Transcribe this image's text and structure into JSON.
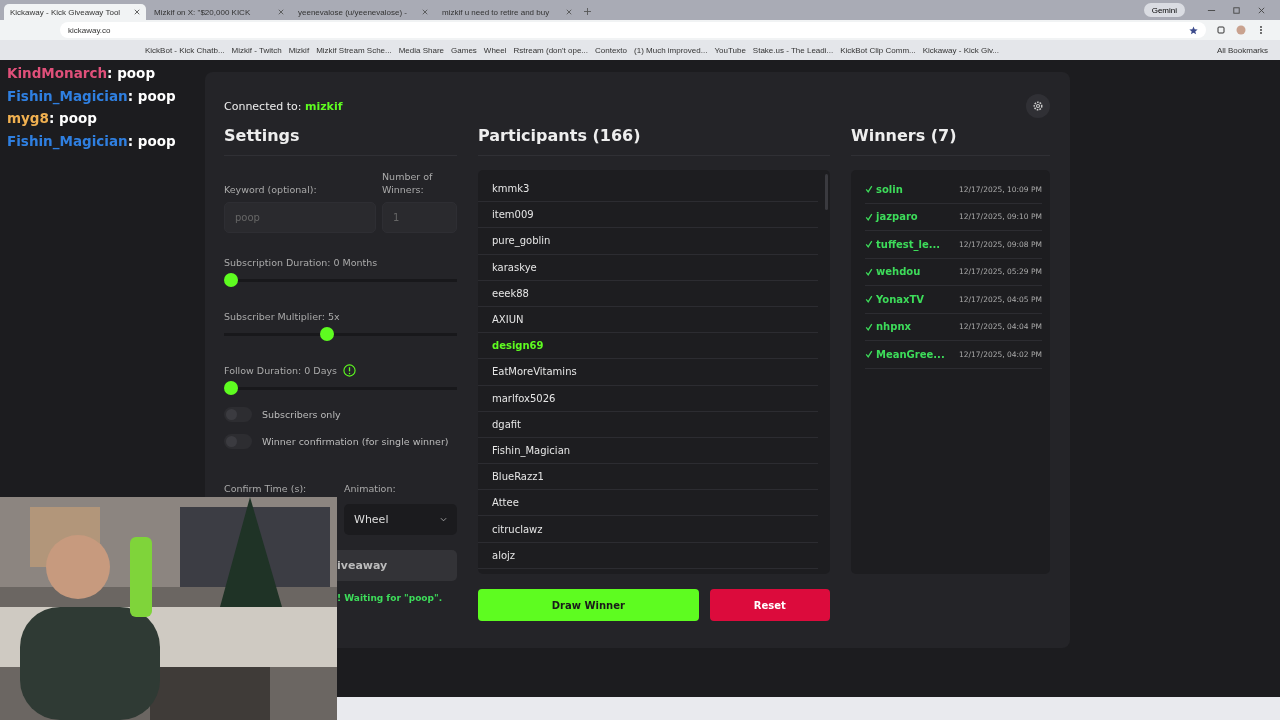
{
  "browser": {
    "tabs": [
      {
        "title": "Kickaway - Kick Giveaway Tool",
        "selected": true
      },
      {
        "title": "Mizkif on X: \"$20,000 KICK",
        "selected": false
      },
      {
        "title": "yeenevalose (u/yeenevalose) -",
        "selected": false
      },
      {
        "title": "mizkif u need to retire and buy",
        "selected": false
      }
    ],
    "gemini_label": "Gemini",
    "address": "kickaway.co",
    "bookmarks": [
      "KickBot - Kick Chatb...",
      "Mizkif - Twitch",
      "Mizkif",
      "Mizkif Stream Sche...",
      "Media Share",
      "Games",
      "Wheel",
      "Rstream (don't ope...",
      "Contexto",
      "(1) Much improved...",
      "YouTube",
      "Stake.us - The Leadi...",
      "KickBot Clip Comm...",
      "Kickaway - Kick Giv..."
    ],
    "all_bookmarks": "All Bookmarks"
  },
  "chat": [
    {
      "user": "KindMonarch",
      "text": ": poop",
      "color": "#e0507a"
    },
    {
      "user": "Fishin_Magician",
      "text": ": poop",
      "color": "#2f7fe0"
    },
    {
      "user": "myg8",
      "text": ": poop",
      "color": "#f0b050"
    },
    {
      "user": "Fishin_Magician",
      "text": ": poop",
      "color": "#2f7fe0"
    }
  ],
  "app": {
    "connected_label": "Connected to:",
    "channel": "mizkif",
    "settings": {
      "title": "Settings",
      "keyword_label": "Keyword (optional):",
      "keyword_placeholder": "poop",
      "winners_label": "Number of Winners:",
      "winners_placeholder": "1",
      "sliders": [
        {
          "label": "Subscription Duration: 0 Months",
          "level": 0,
          "info": false
        },
        {
          "label": "Subscriber Multiplier: 5x",
          "level": 0.44,
          "info": false
        },
        {
          "label": "Follow Duration: 0 Days",
          "level": 0,
          "info": true
        }
      ],
      "toggles": [
        {
          "label": "Subscribers only",
          "on": false
        },
        {
          "label": "Winner confirmation (for single winner)",
          "on": false
        }
      ],
      "confirm_label": "Confirm Time (s):",
      "animation_label": "Animation:",
      "animation_value": "Wheel",
      "start_label": "iveaway",
      "status": "! Waiting for \"poop\"."
    },
    "participants": {
      "title": "Participants (166)",
      "names": [
        {
          "name": "kmmk3",
          "highlighted": false
        },
        {
          "name": "item009",
          "highlighted": false
        },
        {
          "name": "pure_goblin",
          "highlighted": false
        },
        {
          "name": "karaskye",
          "highlighted": false
        },
        {
          "name": "eeek88",
          "highlighted": false
        },
        {
          "name": "AXIUN",
          "highlighted": false
        },
        {
          "name": "design69",
          "highlighted": true
        },
        {
          "name": "EatMoreVitamins",
          "highlighted": false
        },
        {
          "name": "marlfox5026",
          "highlighted": false
        },
        {
          "name": "dgafit",
          "highlighted": false
        },
        {
          "name": "Fishin_Magician",
          "highlighted": false
        },
        {
          "name": "BlueRazz1",
          "highlighted": false
        },
        {
          "name": "Attee",
          "highlighted": false
        },
        {
          "name": "citruclawz",
          "highlighted": false
        },
        {
          "name": "alojz",
          "highlighted": false
        }
      ]
    },
    "winners": {
      "title": "Winners (7)",
      "items": [
        {
          "name": "solin",
          "time": "12/17/2025, 10:09 PM"
        },
        {
          "name": "jazparo",
          "time": "12/17/2025, 09:10 PM"
        },
        {
          "name": "tuffest_le...",
          "time": "12/17/2025, 09:08 PM"
        },
        {
          "name": "wehdou",
          "time": "12/17/2025, 05:29 PM"
        },
        {
          "name": "YonaxTV",
          "time": "12/17/2025, 04:05 PM"
        },
        {
          "name": "nhpnx",
          "time": "12/17/2025, 04:04 PM"
        },
        {
          "name": "MeanGree...",
          "time": "12/17/2025, 04:02 PM"
        }
      ]
    },
    "draw_label": "Draw Winner",
    "reset_label": "Reset"
  }
}
